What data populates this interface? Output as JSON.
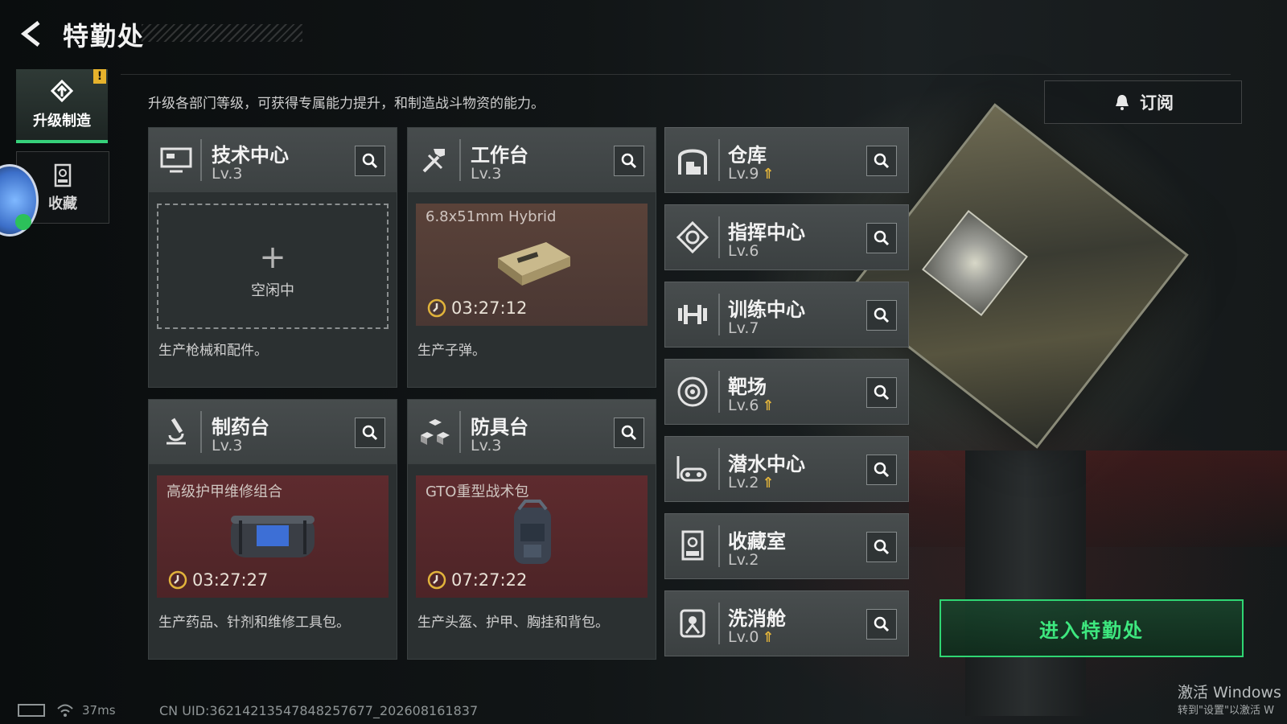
{
  "header": {
    "title": "特勤处",
    "description": "升级各部门等级，可获得专属能力提升，和制造战斗物资的能力。",
    "subscribe_label": "订阅"
  },
  "tabs": [
    {
      "label": "升级制造",
      "active": true,
      "badge": "!"
    },
    {
      "label": "收藏",
      "active": false
    }
  ],
  "workbenches": [
    {
      "name": "技术中心",
      "level": "Lv.3",
      "slot": {
        "state": "idle",
        "plus": "+",
        "label": "空闲中"
      },
      "footer": "生产枪械和配件。"
    },
    {
      "name": "工作台",
      "level": "Lv.3",
      "slot": {
        "state": "producing",
        "item": "6.8x51mm Hybrid",
        "timer": "03:27:12"
      },
      "footer": "生产子弹。"
    },
    {
      "name": "制药台",
      "level": "Lv.3",
      "slot": {
        "state": "producing",
        "item": "高级护甲维修组合",
        "timer": "03:27:27"
      },
      "footer": "生产药品、针剂和维修工具包。"
    },
    {
      "name": "防具台",
      "level": "Lv.3",
      "slot": {
        "state": "producing",
        "item": "GTO重型战术包",
        "timer": "07:27:22"
      },
      "footer": "生产头盔、护甲、胸挂和背包。"
    }
  ],
  "facilities": [
    {
      "name": "仓库",
      "level": "Lv.9",
      "upgradable": true,
      "icon": "warehouse-icon"
    },
    {
      "name": "指挥中心",
      "level": "Lv.6",
      "upgradable": false,
      "icon": "command-icon"
    },
    {
      "name": "训练中心",
      "level": "Lv.7",
      "upgradable": false,
      "icon": "dumbbell-icon"
    },
    {
      "name": "靶场",
      "level": "Lv.6",
      "upgradable": true,
      "icon": "target-icon"
    },
    {
      "name": "潜水中心",
      "level": "Lv.2",
      "upgradable": true,
      "icon": "diving-mask-icon"
    },
    {
      "name": "收藏室",
      "level": "Lv.2",
      "upgradable": false,
      "icon": "collection-icon"
    },
    {
      "name": "洗消舱",
      "level": "Lv.0",
      "upgradable": true,
      "icon": "decon-icon"
    }
  ],
  "enter_button": "进入特勤处",
  "status_bar": {
    "ping": "37ms",
    "uid": "CN UID:3621421354784825767​7_202608161837"
  },
  "watermark": {
    "line1": "激活 Windows",
    "line2": "转到\"设置\"以激活 W"
  },
  "colors": {
    "accent_green": "#36d17a",
    "upgrade_gold": "#e1b33b",
    "warning": "#e6b22c"
  }
}
